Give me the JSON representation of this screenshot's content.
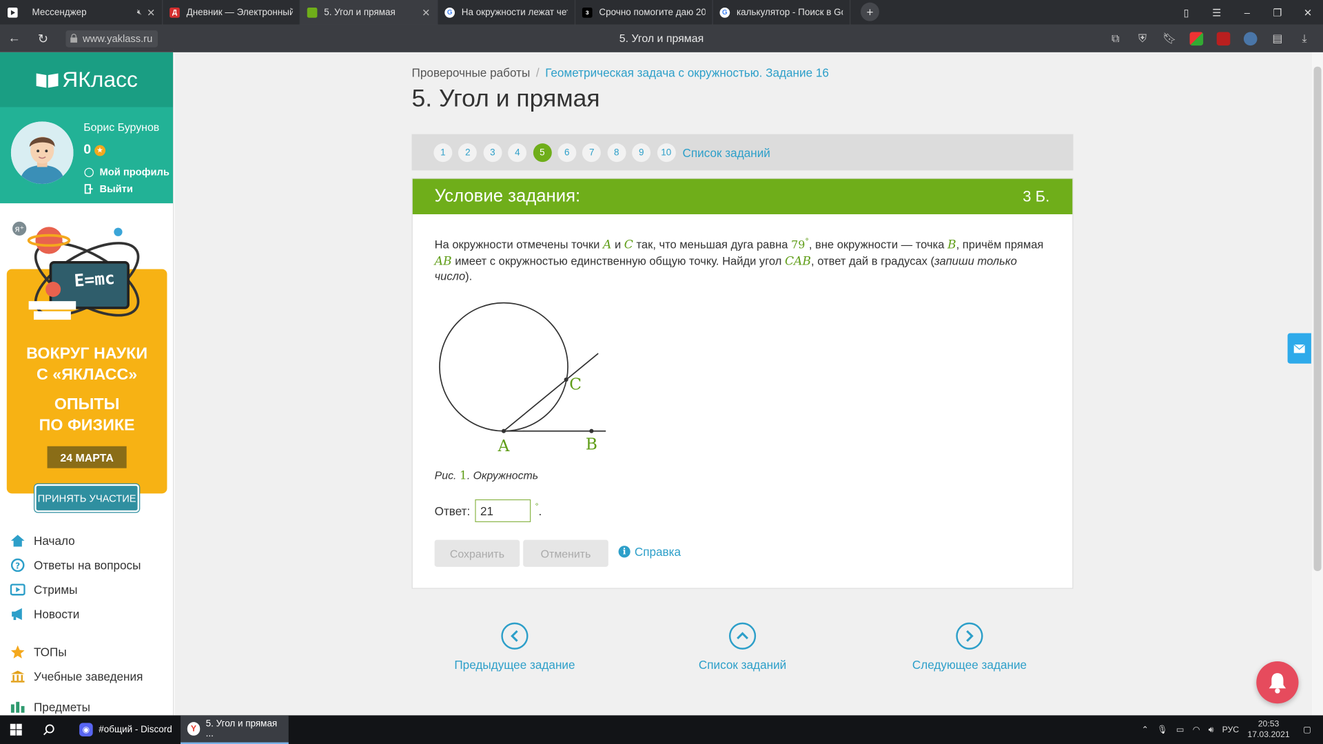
{
  "browser": {
    "tabs": [
      {
        "title": "Мессенджер",
        "color": "#2b2d31"
      },
      {
        "title": "Дневник — Электронный",
        "color": "#d42f2f"
      },
      {
        "title": "5. Угол и прямая",
        "color": "#6fae1a"
      },
      {
        "title": "На окружности лежат чет",
        "color": "#ffffff"
      },
      {
        "title": "Срочно помогите даю 20",
        "color": "#000000"
      },
      {
        "title": "калькулятор - Поиск в Go",
        "color": "#ffffff"
      }
    ],
    "url": "www.yaklass.ru",
    "page_title": "5. Угол и прямая"
  },
  "sidebar": {
    "logo": "ЯКласс",
    "user_name": "Борис Бурунов",
    "points": "0",
    "profile_link": "Мой профиль",
    "logout_link": "Выйти",
    "banner": {
      "formula": "E=mc",
      "line1": "ВОКРУГ НАУКИ",
      "line2": "С «ЯКЛАСС»",
      "line3": "ОПЫТЫ",
      "line4": "ПО ФИЗИКЕ",
      "date": "24 МАРТА",
      "button": "ПРИНЯТЬ УЧАСТИЕ"
    },
    "menu": [
      "Начало",
      "Ответы на вопросы",
      "Стримы",
      "Новости",
      "ТОПы",
      "Учебные заведения",
      "Предметы"
    ]
  },
  "main": {
    "breadcrumb": {
      "root": "Проверочные работы",
      "separator": "/",
      "current": "Геометрическая задача с окружностью. Задание 16"
    },
    "title": "5. Угол и прямая",
    "pager": {
      "pages": [
        "1",
        "2",
        "3",
        "4",
        "5",
        "6",
        "7",
        "8",
        "9",
        "10"
      ],
      "active": "5",
      "list_link": "Список заданий"
    },
    "task": {
      "header": "Условие задания:",
      "points": "3 Б.",
      "text": {
        "p1": "На окружности отмечены точки ",
        "A": "A",
        "and": " и ",
        "C": "C",
        "p2": " так, что меньшая дуга равна ",
        "arc": "79",
        "degree": "°",
        "p3": ", вне окружности — точка ",
        "B": "B",
        "p4": ", причём прямая ",
        "AB": "AB",
        "p5": " имеет с окружностью единственную общую точку. Найди угол ",
        "CAB": "CAB",
        "p6": ", ответ дай в градусах (",
        "note": "запиши только число",
        "p7": ")."
      },
      "figure_labels": {
        "A": "A",
        "B": "B",
        "C": "C"
      },
      "caption": {
        "prefix": "Рис. ",
        "num": "1",
        "suffix": ". Окружность"
      },
      "answer_label": "Ответ:",
      "answer_value": "21",
      "answer_unit": "°",
      "answer_dot": ".",
      "save_button": "Сохранить",
      "cancel_button": "Отменить",
      "help_link": "Справка"
    },
    "bottom_nav": {
      "prev": "Предыдущее задание",
      "list": "Список заданий",
      "next": "Следующее задание"
    }
  },
  "taskbar": {
    "apps": [
      {
        "title": "#общий - Discord"
      },
      {
        "title": "5. Угол и прямая ..."
      }
    ],
    "lang": "РУС",
    "time": "20:53",
    "date": "17.03.2021"
  },
  "colors": {
    "brand_green": "#6fae1a",
    "brand_teal": "#1a9e83",
    "link_blue": "#2d9fc9",
    "banner_yellow": "#f7b214"
  }
}
